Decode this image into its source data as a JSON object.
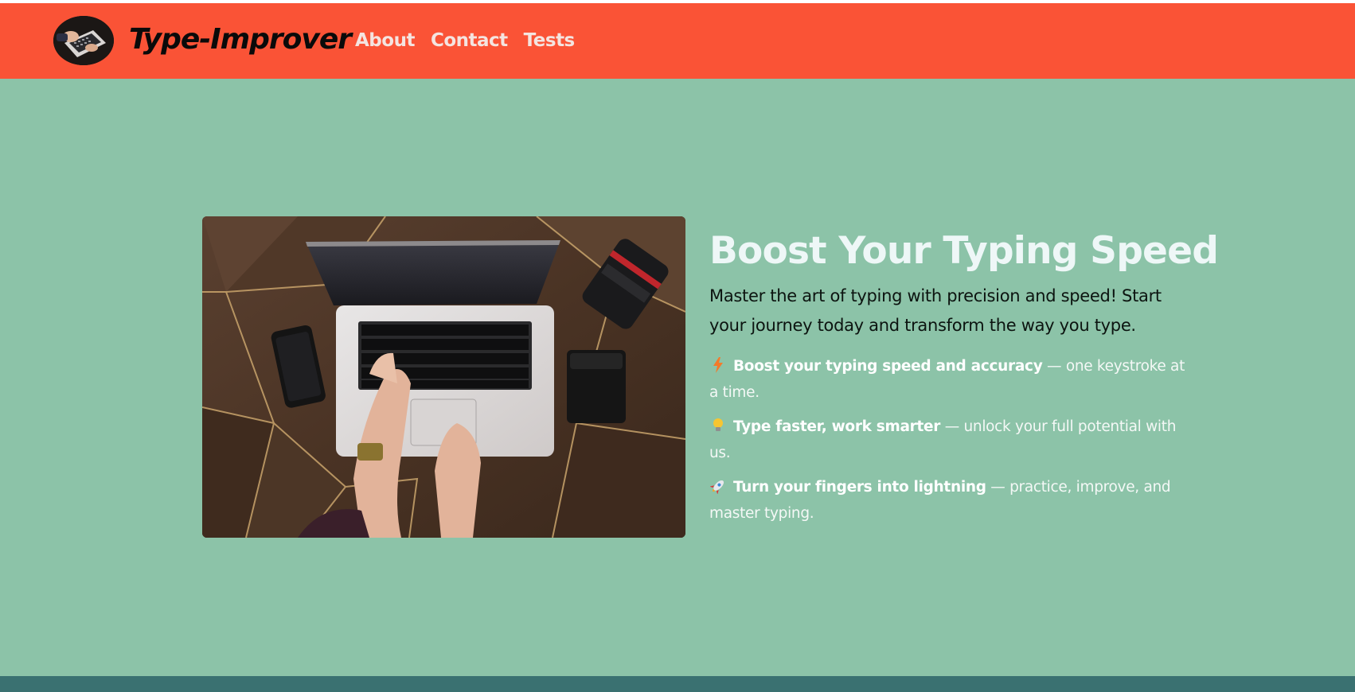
{
  "header": {
    "brand": "Type-Improver",
    "logo_alt": "person typing on laptop",
    "nav": [
      {
        "label": "About"
      },
      {
        "label": "Contact"
      },
      {
        "label": "Tests"
      }
    ]
  },
  "hero": {
    "image_alt": "laptop on wooden desk with phone, wallet and camera lens",
    "title": "Boost Your Typing Speed",
    "intro": "Master the art of typing with precision and speed! Start your journey today and transform the way you type.",
    "features": [
      {
        "icon": "lightning-icon",
        "strong": "Boost your typing speed and accuracy",
        "rest": " — one keystroke at a time."
      },
      {
        "icon": "lightbulb-icon",
        "strong": "Type faster, work smarter",
        "rest": " — unlock your full potential with us."
      },
      {
        "icon": "rocket-icon",
        "strong": "Turn your fingers into lightning",
        "rest": " — practice, improve, and master typing."
      }
    ]
  },
  "colors": {
    "header_bg": "#fa5336",
    "page_bg": "#8cc3a8",
    "footer_bg": "#3a7171",
    "title": "#eef7f7"
  }
}
